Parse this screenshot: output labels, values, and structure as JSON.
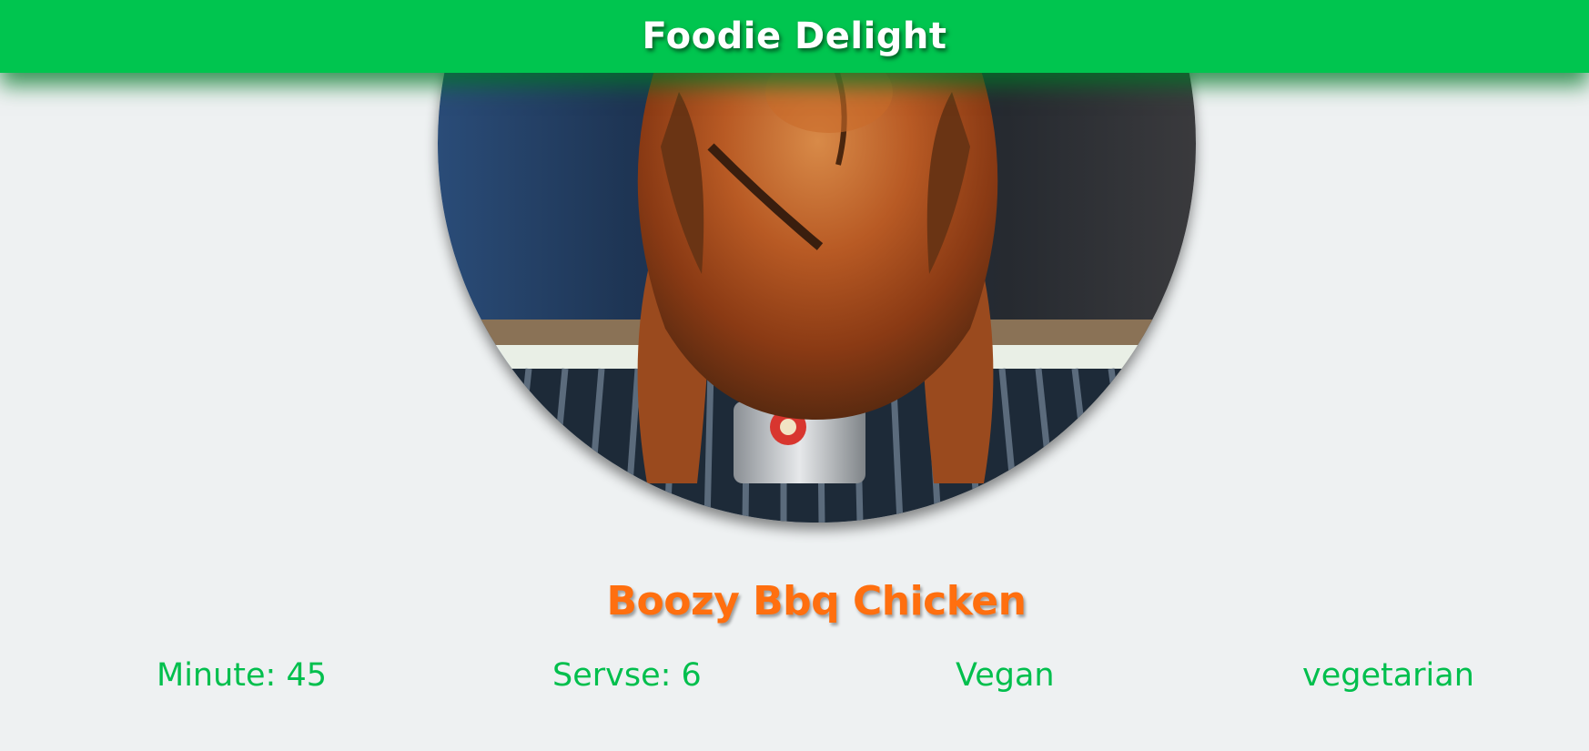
{
  "header": {
    "title": "Foodie Delight",
    "background_color": "#00c54f"
  },
  "recipe": {
    "image_icon": "roast-chicken-photo",
    "title": "Boozy Bbq Chicken",
    "title_color": "#ff6f0f",
    "meta": {
      "minutes": "Minute: 45",
      "serves": "Servse: 6",
      "vegan": "Vegan",
      "vegetarian": "vegetarian"
    },
    "meta_color": "#00bf4d"
  }
}
